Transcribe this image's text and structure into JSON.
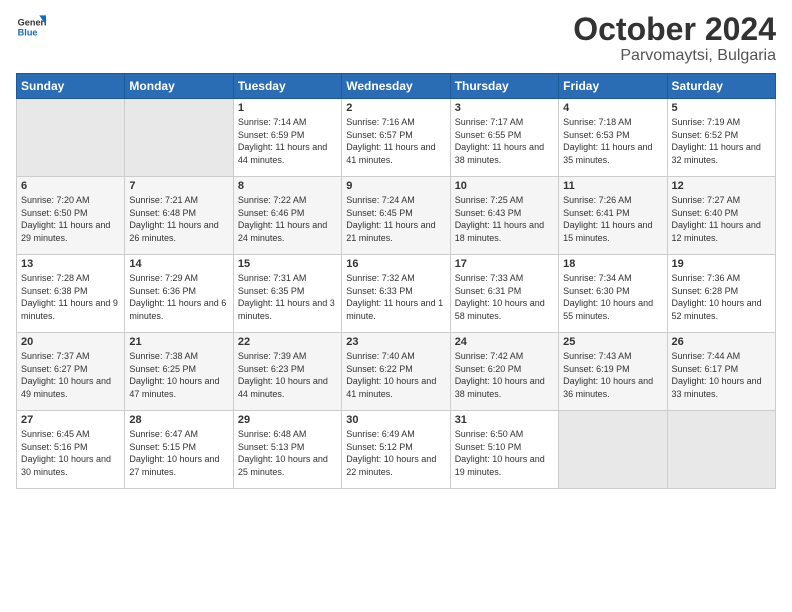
{
  "header": {
    "logo_general": "General",
    "logo_blue": "Blue",
    "month": "October 2024",
    "location": "Parvomaytsi, Bulgaria"
  },
  "weekdays": [
    "Sunday",
    "Monday",
    "Tuesday",
    "Wednesday",
    "Thursday",
    "Friday",
    "Saturday"
  ],
  "weeks": [
    [
      {
        "day": "",
        "sunrise": "",
        "sunset": "",
        "daylight": ""
      },
      {
        "day": "",
        "sunrise": "",
        "sunset": "",
        "daylight": ""
      },
      {
        "day": "1",
        "sunrise": "Sunrise: 7:14 AM",
        "sunset": "Sunset: 6:59 PM",
        "daylight": "Daylight: 11 hours and 44 minutes."
      },
      {
        "day": "2",
        "sunrise": "Sunrise: 7:16 AM",
        "sunset": "Sunset: 6:57 PM",
        "daylight": "Daylight: 11 hours and 41 minutes."
      },
      {
        "day": "3",
        "sunrise": "Sunrise: 7:17 AM",
        "sunset": "Sunset: 6:55 PM",
        "daylight": "Daylight: 11 hours and 38 minutes."
      },
      {
        "day": "4",
        "sunrise": "Sunrise: 7:18 AM",
        "sunset": "Sunset: 6:53 PM",
        "daylight": "Daylight: 11 hours and 35 minutes."
      },
      {
        "day": "5",
        "sunrise": "Sunrise: 7:19 AM",
        "sunset": "Sunset: 6:52 PM",
        "daylight": "Daylight: 11 hours and 32 minutes."
      }
    ],
    [
      {
        "day": "6",
        "sunrise": "Sunrise: 7:20 AM",
        "sunset": "Sunset: 6:50 PM",
        "daylight": "Daylight: 11 hours and 29 minutes."
      },
      {
        "day": "7",
        "sunrise": "Sunrise: 7:21 AM",
        "sunset": "Sunset: 6:48 PM",
        "daylight": "Daylight: 11 hours and 26 minutes."
      },
      {
        "day": "8",
        "sunrise": "Sunrise: 7:22 AM",
        "sunset": "Sunset: 6:46 PM",
        "daylight": "Daylight: 11 hours and 24 minutes."
      },
      {
        "day": "9",
        "sunrise": "Sunrise: 7:24 AM",
        "sunset": "Sunset: 6:45 PM",
        "daylight": "Daylight: 11 hours and 21 minutes."
      },
      {
        "day": "10",
        "sunrise": "Sunrise: 7:25 AM",
        "sunset": "Sunset: 6:43 PM",
        "daylight": "Daylight: 11 hours and 18 minutes."
      },
      {
        "day": "11",
        "sunrise": "Sunrise: 7:26 AM",
        "sunset": "Sunset: 6:41 PM",
        "daylight": "Daylight: 11 hours and 15 minutes."
      },
      {
        "day": "12",
        "sunrise": "Sunrise: 7:27 AM",
        "sunset": "Sunset: 6:40 PM",
        "daylight": "Daylight: 11 hours and 12 minutes."
      }
    ],
    [
      {
        "day": "13",
        "sunrise": "Sunrise: 7:28 AM",
        "sunset": "Sunset: 6:38 PM",
        "daylight": "Daylight: 11 hours and 9 minutes."
      },
      {
        "day": "14",
        "sunrise": "Sunrise: 7:29 AM",
        "sunset": "Sunset: 6:36 PM",
        "daylight": "Daylight: 11 hours and 6 minutes."
      },
      {
        "day": "15",
        "sunrise": "Sunrise: 7:31 AM",
        "sunset": "Sunset: 6:35 PM",
        "daylight": "Daylight: 11 hours and 3 minutes."
      },
      {
        "day": "16",
        "sunrise": "Sunrise: 7:32 AM",
        "sunset": "Sunset: 6:33 PM",
        "daylight": "Daylight: 11 hours and 1 minute."
      },
      {
        "day": "17",
        "sunrise": "Sunrise: 7:33 AM",
        "sunset": "Sunset: 6:31 PM",
        "daylight": "Daylight: 10 hours and 58 minutes."
      },
      {
        "day": "18",
        "sunrise": "Sunrise: 7:34 AM",
        "sunset": "Sunset: 6:30 PM",
        "daylight": "Daylight: 10 hours and 55 minutes."
      },
      {
        "day": "19",
        "sunrise": "Sunrise: 7:36 AM",
        "sunset": "Sunset: 6:28 PM",
        "daylight": "Daylight: 10 hours and 52 minutes."
      }
    ],
    [
      {
        "day": "20",
        "sunrise": "Sunrise: 7:37 AM",
        "sunset": "Sunset: 6:27 PM",
        "daylight": "Daylight: 10 hours and 49 minutes."
      },
      {
        "day": "21",
        "sunrise": "Sunrise: 7:38 AM",
        "sunset": "Sunset: 6:25 PM",
        "daylight": "Daylight: 10 hours and 47 minutes."
      },
      {
        "day": "22",
        "sunrise": "Sunrise: 7:39 AM",
        "sunset": "Sunset: 6:23 PM",
        "daylight": "Daylight: 10 hours and 44 minutes."
      },
      {
        "day": "23",
        "sunrise": "Sunrise: 7:40 AM",
        "sunset": "Sunset: 6:22 PM",
        "daylight": "Daylight: 10 hours and 41 minutes."
      },
      {
        "day": "24",
        "sunrise": "Sunrise: 7:42 AM",
        "sunset": "Sunset: 6:20 PM",
        "daylight": "Daylight: 10 hours and 38 minutes."
      },
      {
        "day": "25",
        "sunrise": "Sunrise: 7:43 AM",
        "sunset": "Sunset: 6:19 PM",
        "daylight": "Daylight: 10 hours and 36 minutes."
      },
      {
        "day": "26",
        "sunrise": "Sunrise: 7:44 AM",
        "sunset": "Sunset: 6:17 PM",
        "daylight": "Daylight: 10 hours and 33 minutes."
      }
    ],
    [
      {
        "day": "27",
        "sunrise": "Sunrise: 6:45 AM",
        "sunset": "Sunset: 5:16 PM",
        "daylight": "Daylight: 10 hours and 30 minutes."
      },
      {
        "day": "28",
        "sunrise": "Sunrise: 6:47 AM",
        "sunset": "Sunset: 5:15 PM",
        "daylight": "Daylight: 10 hours and 27 minutes."
      },
      {
        "day": "29",
        "sunrise": "Sunrise: 6:48 AM",
        "sunset": "Sunset: 5:13 PM",
        "daylight": "Daylight: 10 hours and 25 minutes."
      },
      {
        "day": "30",
        "sunrise": "Sunrise: 6:49 AM",
        "sunset": "Sunset: 5:12 PM",
        "daylight": "Daylight: 10 hours and 22 minutes."
      },
      {
        "day": "31",
        "sunrise": "Sunrise: 6:50 AM",
        "sunset": "Sunset: 5:10 PM",
        "daylight": "Daylight: 10 hours and 19 minutes."
      },
      {
        "day": "",
        "sunrise": "",
        "sunset": "",
        "daylight": ""
      },
      {
        "day": "",
        "sunrise": "",
        "sunset": "",
        "daylight": ""
      }
    ]
  ]
}
